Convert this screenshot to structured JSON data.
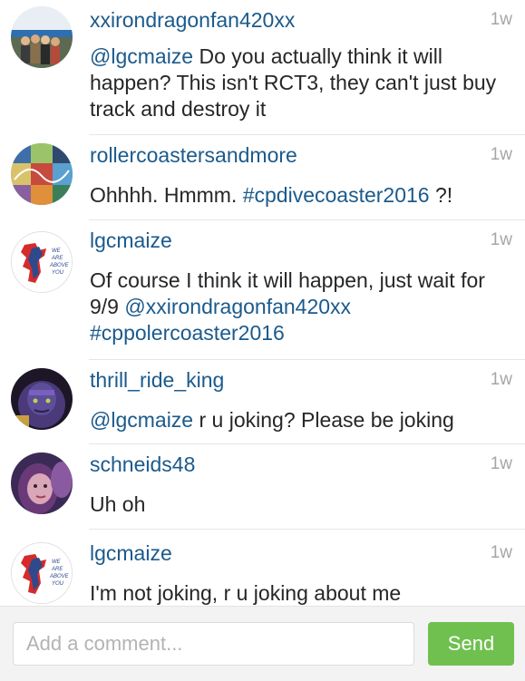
{
  "comments": [
    {
      "username": "xxirondragonfan420xx",
      "time": "1w",
      "avatar_icon": "group-photo-avatar",
      "parts": [
        "",
        "@lgcmaize",
        " Do you actually think it will happen? This isn't RCT3, they can't just buy track and destroy it"
      ]
    },
    {
      "username": "rollercoastersandmore",
      "time": "1w",
      "avatar_icon": "collage-avatar",
      "parts": [
        "Ohhhh. Hmmm. ",
        "#cpdivecoaster2016",
        " ?!"
      ]
    },
    {
      "username": "lgcmaize",
      "time": "1w",
      "avatar_icon": "we-are-above-you-logo-avatar",
      "avatar_text": [
        "WE",
        "ARE",
        "ABOVE",
        "YOU"
      ],
      "parts": [
        "Of course I think it will happen, just wait for 9/9 ",
        "@xxirondragonfan420xx",
        " ",
        "#cppolercoaster2016"
      ]
    },
    {
      "username": "thrill_ride_king",
      "time": "1w",
      "avatar_icon": "villain-photo-avatar",
      "parts": [
        "",
        "@lgcmaize",
        " r u joking? Please be joking"
      ]
    },
    {
      "username": "schneids48",
      "time": "1w",
      "avatar_icon": "selfie-photo-avatar",
      "parts": [
        "Uh oh"
      ]
    },
    {
      "username": "lgcmaize",
      "time": "1w",
      "avatar_icon": "we-are-above-you-logo-avatar",
      "avatar_text": [
        "WE",
        "ARE",
        "ABOVE",
        "YOU"
      ],
      "parts": [
        "I'm not joking, r u joking about me"
      ]
    }
  ],
  "composer": {
    "placeholder": "Add a comment...",
    "send_label": "Send"
  },
  "colors": {
    "link": "#1b5a8c",
    "send_button": "#70c050",
    "logo_red": "#d52b2b",
    "logo_blue": "#2e4a8c"
  }
}
